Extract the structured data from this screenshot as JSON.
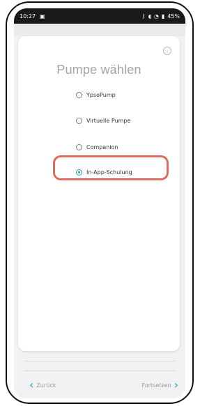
{
  "statusbar": {
    "time": "10:27",
    "left_icon": "image-notification-icon",
    "right_icons": [
      "bluetooth-icon",
      "mute-icon",
      "wifi-icon",
      "signal-icon"
    ],
    "battery_text": "45%"
  },
  "screen": {
    "title": "Pumpe wählen",
    "info_icon": "info-icon",
    "options": [
      {
        "label": "YpsoPump",
        "selected": false
      },
      {
        "label": "Virtuelle Pumpe",
        "selected": false
      },
      {
        "label": "Companion",
        "selected": false
      },
      {
        "label": "In-App-Schulung",
        "selected": true
      }
    ],
    "highlight_color": "#e06b5f",
    "accent_color": "#1aa3b7"
  },
  "footer": {
    "back_label": "Zurück",
    "next_label": "Fortsetzen",
    "back_icon": "chevron-left-icon",
    "next_icon": "chevron-right-icon"
  }
}
